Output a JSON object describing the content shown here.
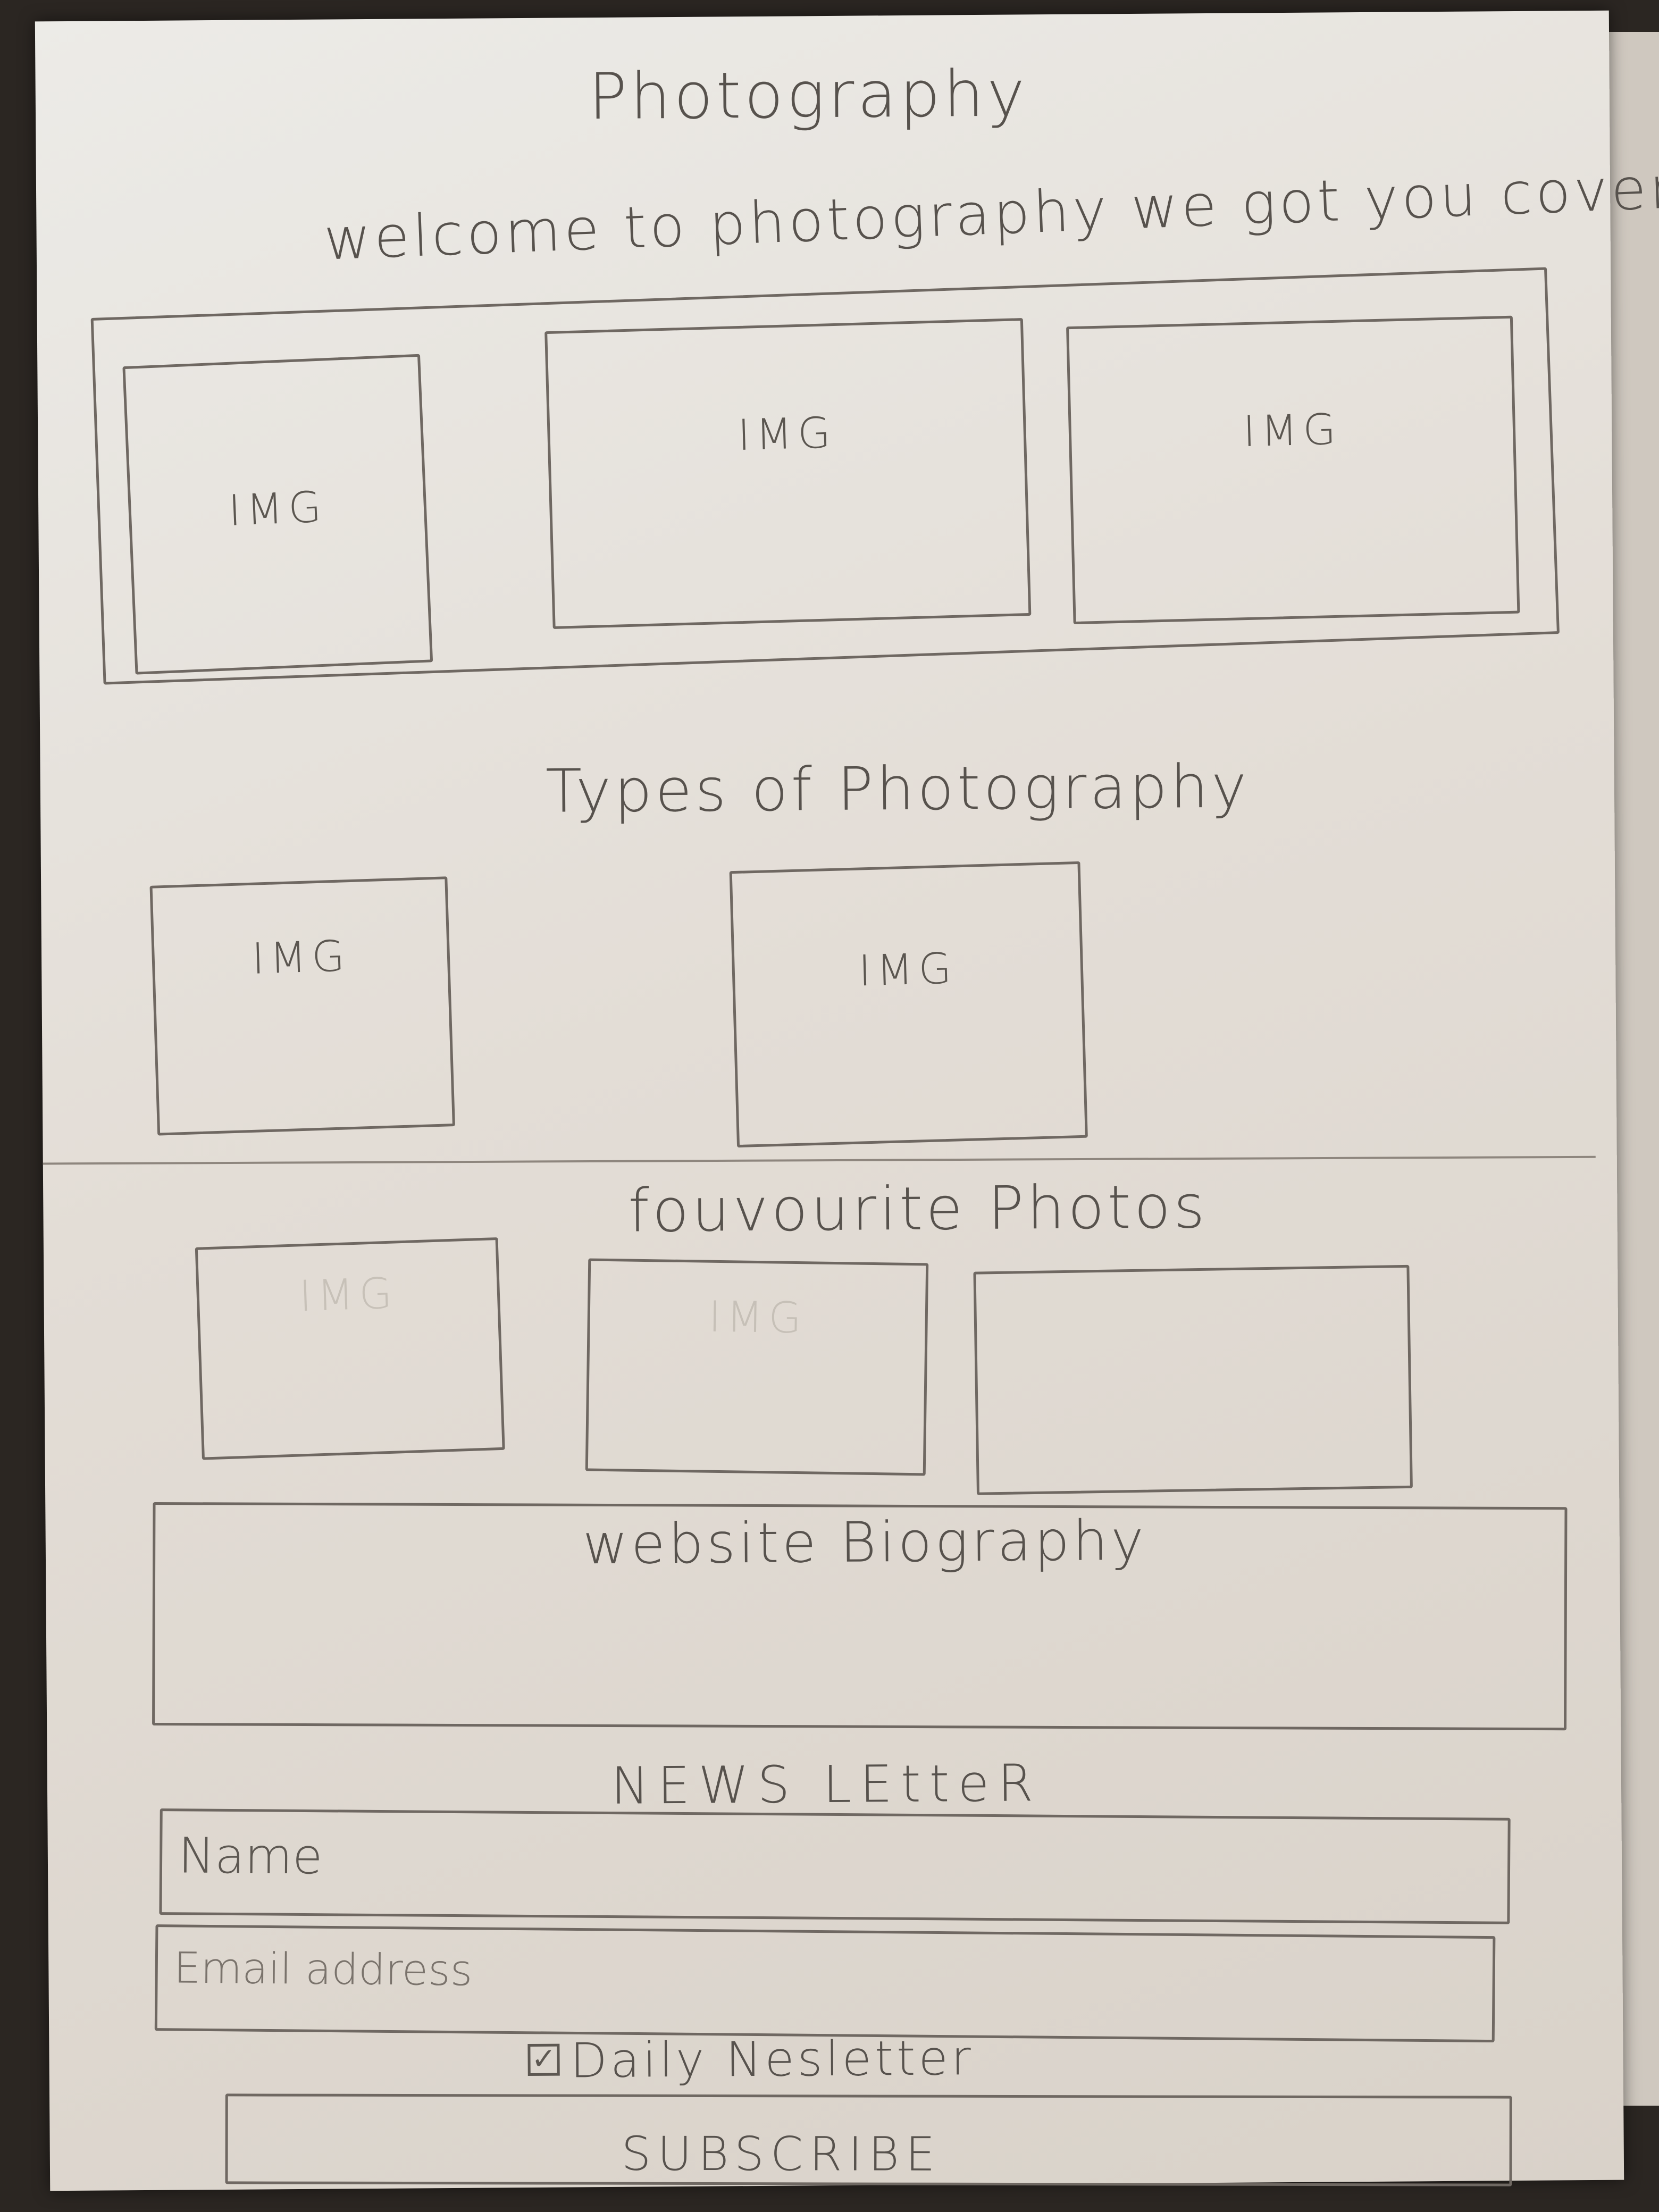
{
  "header": {
    "title": "Photography",
    "tagline": "welcome to photography we got you covered"
  },
  "gallery": {
    "images": [
      {
        "label": "IMG"
      },
      {
        "label": "IMG"
      },
      {
        "label": "IMG"
      }
    ]
  },
  "types_section": {
    "heading": "Types of Photography",
    "images": [
      {
        "label": "IMG"
      },
      {
        "label": "IMG"
      }
    ]
  },
  "favourites_section": {
    "heading": "fouvourite Photos",
    "images": [
      {
        "label": "IMG"
      },
      {
        "label": "IMG"
      },
      {
        "label": ""
      }
    ]
  },
  "biography": {
    "heading": "website Biography"
  },
  "newsletter": {
    "heading": "NEWS LEtteR",
    "name_placeholder": "Name",
    "email_placeholder": "Email address",
    "checkbox_label": "Daily Nesletter",
    "checkbox_checked": true,
    "subscribe_label": "SUBSCRIBE"
  }
}
